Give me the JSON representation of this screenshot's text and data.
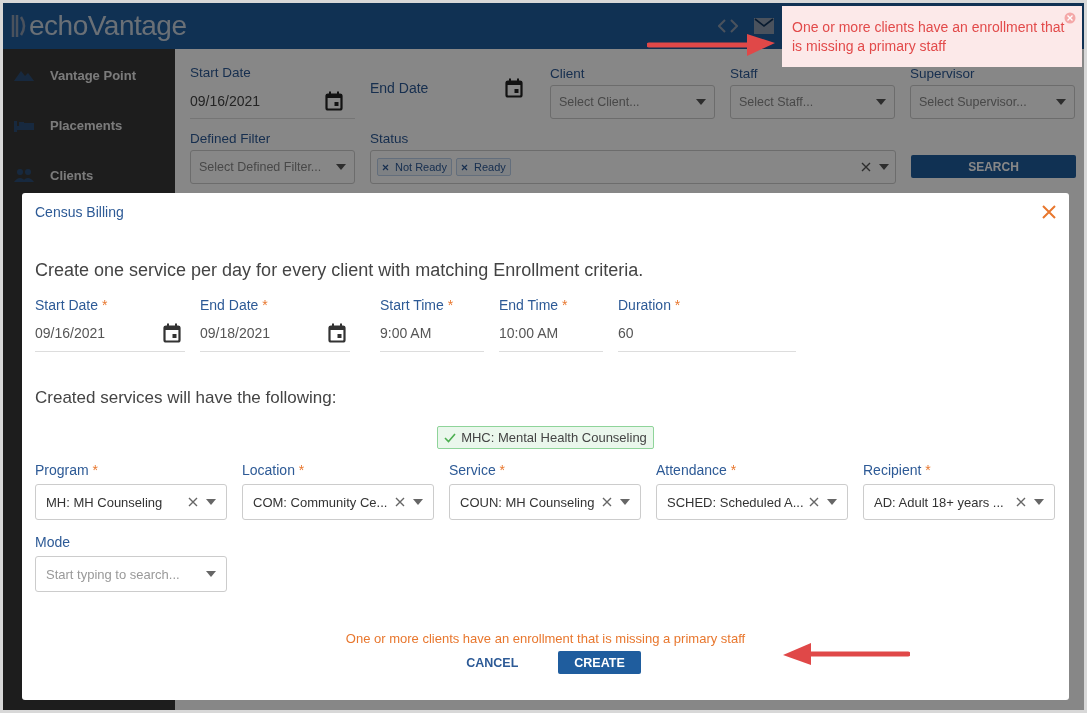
{
  "app": {
    "logo": "echoVantage",
    "sidebar": {
      "items": [
        {
          "label": "Vantage Point"
        },
        {
          "label": "Placements"
        },
        {
          "label": "Clients"
        }
      ]
    },
    "filters": {
      "start_date": {
        "label": "Start Date",
        "value": "09/16/2021"
      },
      "end_date": {
        "label": "End Date"
      },
      "selects": [
        {
          "label": "Client",
          "placeholder": "Select Client..."
        },
        {
          "label": "Staff",
          "placeholder": "Select Staff..."
        },
        {
          "label": "Supervisor",
          "placeholder": "Select Supervisor..."
        }
      ],
      "defined_filter": {
        "label": "Defined Filter",
        "placeholder": "Select Defined Filter..."
      },
      "status": {
        "label": "Status",
        "chips": [
          "Not Ready",
          "Ready"
        ]
      },
      "search_button": "SEARCH"
    }
  },
  "toast": {
    "message": "One or more clients have an enrollment that is missing a primary staff"
  },
  "modal": {
    "title": "Census Billing",
    "intro": "Create one service per day for every client with matching Enrollment criteria.",
    "fields": [
      {
        "label": "Start Date",
        "mark": "*",
        "value": "09/16/2021",
        "kind": "date"
      },
      {
        "label": "End Date",
        "mark": "*",
        "value": "09/18/2021",
        "kind": "date"
      },
      {
        "label": "Start Time",
        "mark": "*",
        "value": "9:00 AM",
        "kind": "text"
      },
      {
        "label": "End Time",
        "mark": "*",
        "value": "10:00 AM",
        "kind": "text"
      },
      {
        "label": "Duration",
        "mark": "*",
        "value": "60",
        "kind": "text"
      }
    ],
    "section_heading": "Created services will have the following:",
    "service_badge": "MHC: Mental Health Counseling",
    "selects": [
      {
        "label": "Program",
        "mark": "*",
        "value": "MH: MH Counseling"
      },
      {
        "label": "Location",
        "mark": "*",
        "value": "COM: Community Ce..."
      },
      {
        "label": "Service",
        "mark": "*",
        "value": "COUN: MH Counseling"
      },
      {
        "label": "Attendance",
        "mark": "*",
        "value": "SCHED: Scheduled A..."
      },
      {
        "label": "Recipient",
        "mark": "*",
        "value": "AD: Adult 18+ years ..."
      }
    ],
    "mode": {
      "label": "Mode",
      "placeholder": "Start typing to search..."
    },
    "error": "One or more clients have an enrollment that is missing a primary staff",
    "buttons": [
      {
        "label": "CANCEL",
        "kind": "secondary"
      },
      {
        "label": "CREATE",
        "kind": "primary"
      }
    ]
  }
}
